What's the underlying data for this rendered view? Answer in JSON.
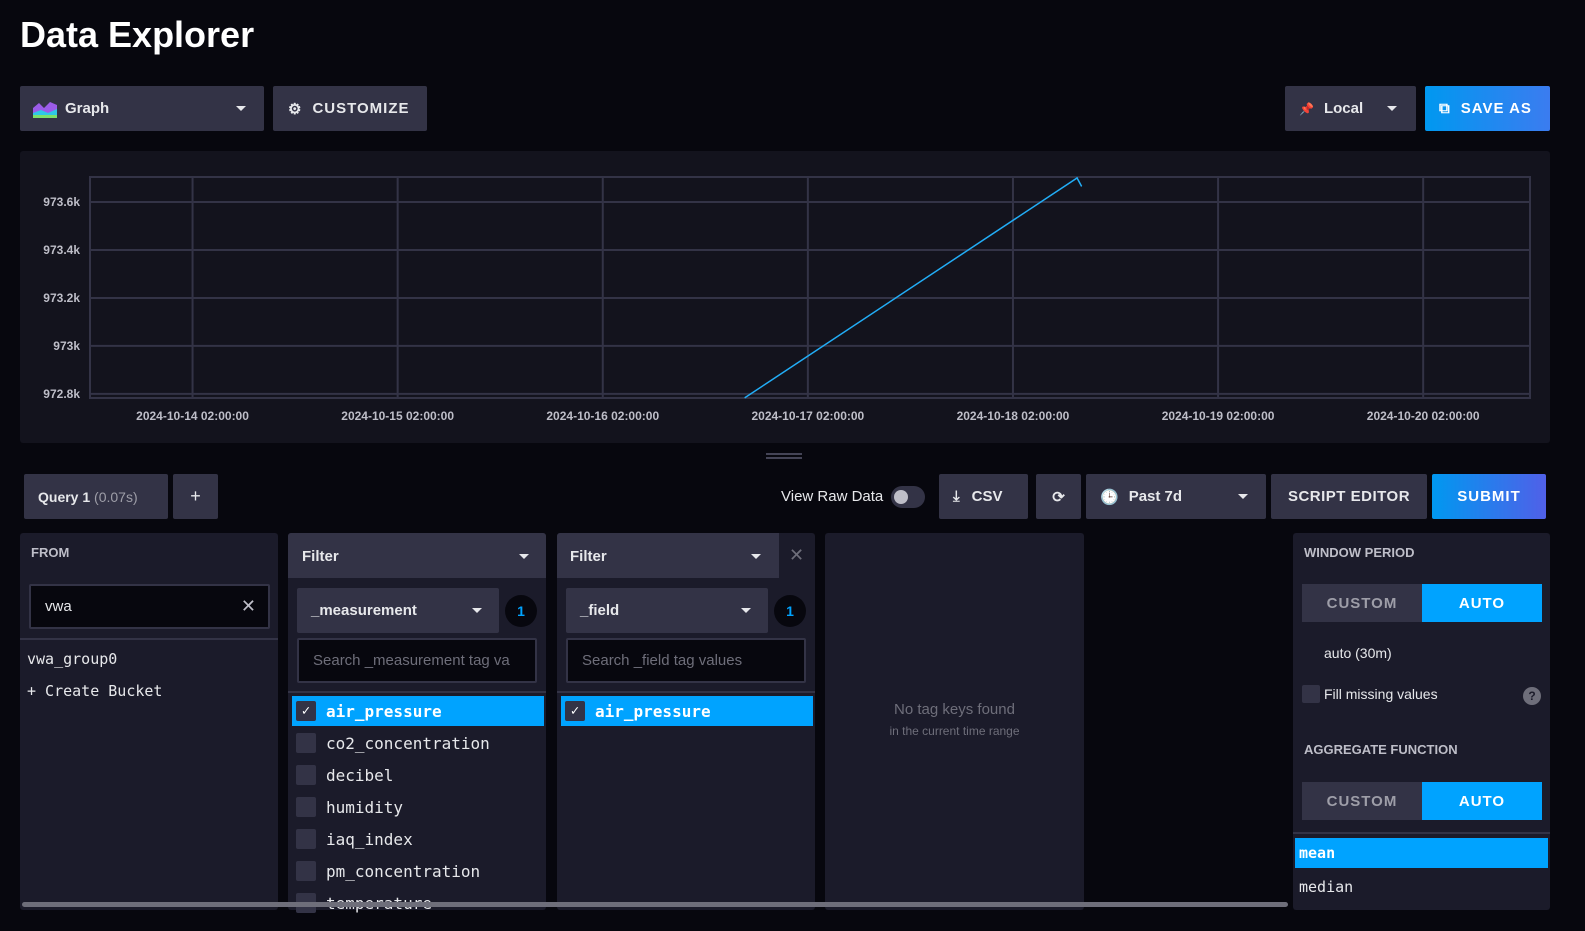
{
  "title": "Data Explorer",
  "toolbar": {
    "viz_type": "Graph",
    "customize": "CUSTOMIZE",
    "timezone": "Local",
    "save_as": "SAVE AS"
  },
  "chart_data": {
    "type": "line",
    "ylim": [
      972783,
      973704
    ],
    "xlim": [
      "2024-10-13T14:00:00Z",
      "2024-10-20T14:30:00Z"
    ],
    "yticks": [
      {
        "v": 973600,
        "label": "973.6k"
      },
      {
        "v": 973400,
        "label": "973.4k"
      },
      {
        "v": 973200,
        "label": "973.2k"
      },
      {
        "v": 973000,
        "label": "973k"
      },
      {
        "v": 972800,
        "label": "972.8k"
      }
    ],
    "xticks": [
      {
        "t": "2024-10-14T02:00:00Z",
        "label": "2024-10-14 02:00:00"
      },
      {
        "t": "2024-10-15T02:00:00Z",
        "label": "2024-10-15 02:00:00"
      },
      {
        "t": "2024-10-16T02:00:00Z",
        "label": "2024-10-16 02:00:00"
      },
      {
        "t": "2024-10-17T02:00:00Z",
        "label": "2024-10-17 02:00:00"
      },
      {
        "t": "2024-10-18T02:00:00Z",
        "label": "2024-10-18 02:00:00"
      },
      {
        "t": "2024-10-19T02:00:00Z",
        "label": "2024-10-19 02:00:00"
      },
      {
        "t": "2024-10-20T02:00:00Z",
        "label": "2024-10-20 02:00:00"
      }
    ],
    "series": [
      {
        "name": "air_pressure",
        "color": "#22adf6",
        "points": [
          [
            "2024-10-16T18:40:00Z",
            972785
          ],
          [
            "2024-10-18T09:30:00Z",
            973700
          ],
          [
            "2024-10-18T10:00:00Z",
            973667
          ]
        ]
      }
    ],
    "grid": true
  },
  "query": {
    "tab": "Query 1",
    "time": "(0.07s)",
    "add": "+",
    "view_raw": "View Raw Data",
    "csv": "CSV",
    "range": "Past 7d",
    "script_editor": "SCRIPT EDITOR",
    "submit": "SUBMIT"
  },
  "from": {
    "label": "FROM",
    "search": "vwa",
    "buckets": [
      "vwa_group0"
    ],
    "create": "+ Create Bucket"
  },
  "filter1": {
    "label": "Filter",
    "key": "_measurement",
    "count": "1",
    "placeholder": "Search _measurement tag va",
    "items": [
      {
        "name": "air_pressure",
        "checked": true
      },
      {
        "name": "co2_concentration"
      },
      {
        "name": "decibel"
      },
      {
        "name": "humidity"
      },
      {
        "name": "iaq_index"
      },
      {
        "name": "pm_concentration"
      },
      {
        "name": "temperature"
      }
    ]
  },
  "filter2": {
    "label": "Filter",
    "key": "_field",
    "count": "1",
    "placeholder": "Search _field tag values",
    "items": [
      {
        "name": "air_pressure",
        "checked": true
      }
    ]
  },
  "empty": {
    "title": "No tag keys found",
    "sub": "in the current time range"
  },
  "window": {
    "label": "WINDOW PERIOD",
    "custom": "CUSTOM",
    "auto": "AUTO",
    "value": "auto (30m)",
    "fill": "Fill missing values",
    "help": "?"
  },
  "aggregate": {
    "label": "AGGREGATE FUNCTION",
    "custom": "CUSTOM",
    "auto": "AUTO",
    "functions": [
      "mean",
      "median"
    ]
  }
}
